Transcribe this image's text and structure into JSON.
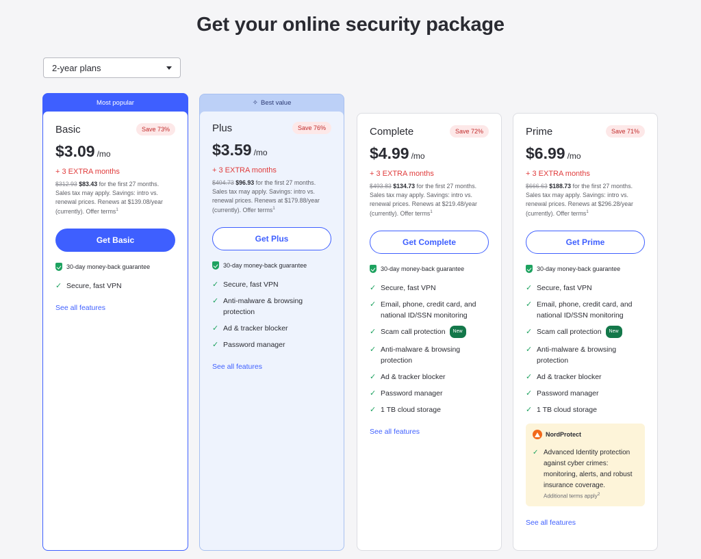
{
  "page_title": "Get your online security package",
  "plan_select": {
    "value": "2-year plans"
  },
  "plans": [
    {
      "banner": "Most popular",
      "name": "Basic",
      "save": "Save 73%",
      "price": "$3.09",
      "per": "/mo",
      "extra": "+ 3 EXTRA months",
      "old_price": "$312.93",
      "new_price": "$83.43",
      "terms": " for the first 27 months. Sales tax may apply. Savings: intro vs. renewal prices. Renews at $139.08/year (currently). Offer terms",
      "cta": "Get Basic",
      "guarantee": "30-day money-back guarantee",
      "features": [
        "Secure, fast VPN"
      ],
      "see_all": "See all features"
    },
    {
      "banner": "Best value",
      "name": "Plus",
      "save": "Save 76%",
      "price": "$3.59",
      "per": "/mo",
      "extra": "+ 3 EXTRA months",
      "old_price": "$404.73",
      "new_price": "$96.93",
      "terms": " for the first 27 months. Sales tax may apply. Savings: intro vs. renewal prices. Renews at $179.88/year (currently). Offer terms",
      "cta": "Get Plus",
      "guarantee": "30-day money-back guarantee",
      "features": [
        "Secure, fast VPN",
        "Anti-malware & browsing protection",
        "Ad & tracker blocker",
        "Password manager"
      ],
      "see_all": "See all features"
    },
    {
      "name": "Complete",
      "save": "Save 72%",
      "price": "$4.99",
      "per": "/mo",
      "extra": "+ 3 EXTRA months",
      "old_price": "$493.83",
      "new_price": "$134.73",
      "terms": " for the first 27 months. Sales tax may apply. Savings: intro vs. renewal prices. Renews at $219.48/year (currently). Offer terms",
      "cta": "Get Complete",
      "guarantee": "30-day money-back guarantee",
      "features": [
        "Secure, fast VPN",
        "Email, phone, credit card, and national ID/SSN monitoring",
        "Scam call protection",
        "Anti-malware & browsing protection",
        "Ad & tracker blocker",
        "Password manager",
        "1 TB cloud storage"
      ],
      "new_badge": "New",
      "see_all": "See all features"
    },
    {
      "name": "Prime",
      "save": "Save 71%",
      "price": "$6.99",
      "per": "/mo",
      "extra": "+ 3 EXTRA months",
      "old_price": "$666.63",
      "new_price": "$188.73",
      "terms": " for the first 27 months. Sales tax may apply. Savings: intro vs. renewal prices. Renews at $296.28/year (currently). Offer terms",
      "cta": "Get Prime",
      "guarantee": "30-day money-back guarantee",
      "features": [
        "Secure, fast VPN",
        "Email, phone, credit card, and national ID/SSN monitoring",
        "Scam call protection",
        "Anti-malware & browsing protection",
        "Ad & tracker blocker",
        "Password manager",
        "1 TB cloud storage"
      ],
      "new_badge": "New",
      "nordprotect": {
        "logo_text": "NordProtect",
        "feature": "Advanced Identity protection against cyber crimes: monitoring, alerts, and robust insurance coverage.",
        "note": "Additional terms apply"
      },
      "see_all": "See all features"
    }
  ],
  "footnote_marks": {
    "terms": "1",
    "note": "2"
  },
  "colors": {
    "accent": "#3e5fff",
    "check": "#1da25f",
    "extra": "#e03b3b",
    "save_bg": "#fde8e8",
    "plus_bg": "#eef3fd",
    "nord_bg": "#fdf4d9"
  },
  "icons": {
    "shield": "shield-check-icon",
    "check": "check-icon",
    "chevron": "chevron-down-icon",
    "sparkle": "sparkle-icon",
    "nord": "nordprotect-logo-icon"
  }
}
